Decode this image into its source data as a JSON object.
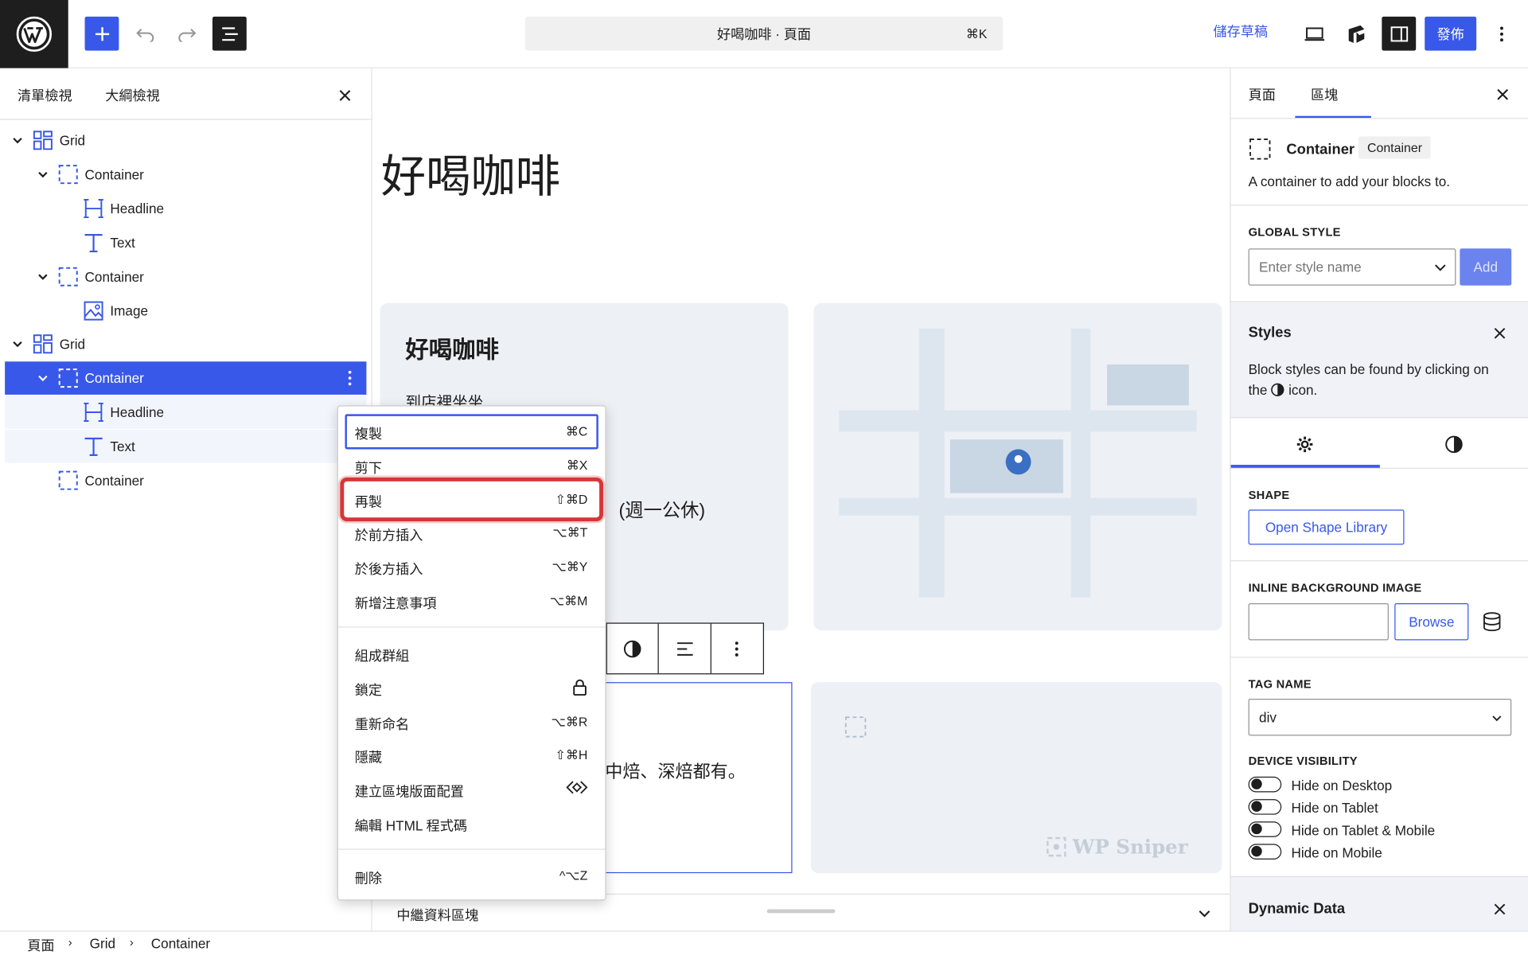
{
  "topbar": {
    "document_title": "好喝咖啡 · 頁面",
    "command_shortcut": "⌘K",
    "save_draft": "儲存草稿",
    "publish": "發佈"
  },
  "list_view": {
    "tabs": [
      "清單檢視",
      "大綱檢視"
    ],
    "items": [
      {
        "label": "Grid",
        "icon": "grid-icon",
        "expanded": true
      },
      {
        "label": "Container",
        "icon": "container-icon",
        "expanded": true
      },
      {
        "label": "Headline",
        "icon": "headline-icon"
      },
      {
        "label": "Text",
        "icon": "text-icon"
      },
      {
        "label": "Container",
        "icon": "container-icon",
        "expanded": true
      },
      {
        "label": "Image",
        "icon": "image-icon"
      },
      {
        "label": "Grid",
        "icon": "grid-icon",
        "expanded": true
      },
      {
        "label": "Container",
        "icon": "container-icon",
        "expanded": true,
        "selected": true
      },
      {
        "label": "Headline",
        "icon": "headline-icon"
      },
      {
        "label": "Text",
        "icon": "text-icon"
      },
      {
        "label": "Container",
        "icon": "container-icon"
      }
    ]
  },
  "canvas": {
    "page_title": "好喝咖啡",
    "card1_title": "好喝咖啡",
    "card1_subtitle": "到店裡坐坐",
    "card1_hours_fragment": "(週一公休)",
    "selected_text_fragment": "中焙、深焙都有。",
    "watermark": "WP Sniper",
    "footer_label": "中繼資料區塊"
  },
  "context_menu": {
    "group1": [
      {
        "label": "複製",
        "shortcut": "⌘C",
        "focused": true
      },
      {
        "label": "剪下",
        "shortcut": "⌘X"
      },
      {
        "label": "再製",
        "shortcut": "⇧⌘D",
        "highlighted": true
      },
      {
        "label": "於前方插入",
        "shortcut": "⌥⌘T"
      },
      {
        "label": "於後方插入",
        "shortcut": "⌥⌘Y"
      },
      {
        "label": "新增注意事項",
        "shortcut": "⌥⌘M"
      }
    ],
    "group2": [
      {
        "label": "組成群組",
        "shortcut": ""
      },
      {
        "label": "鎖定",
        "shortcut": "lock-icon"
      },
      {
        "label": "重新命名",
        "shortcut": "⌥⌘R"
      },
      {
        "label": "隱藏",
        "shortcut": "⇧⌘H"
      },
      {
        "label": "建立區塊版面配置",
        "shortcut": "pattern-icon"
      },
      {
        "label": "編輯 HTML 程式碼",
        "shortcut": ""
      }
    ],
    "group3": [
      {
        "label": "刪除",
        "shortcut": "^⌥Z"
      }
    ]
  },
  "breadcrumb": [
    "頁面",
    "Grid",
    "Container"
  ],
  "inspector": {
    "tabs": [
      "頁面",
      "區塊"
    ],
    "active_tab": "區塊",
    "block_name": "Container",
    "block_badge": "Container",
    "block_description": "A container to add your blocks to.",
    "global_style_label": "GLOBAL STYLE",
    "global_style_placeholder": "Enter style name",
    "add_label": "Add",
    "styles_title": "Styles",
    "styles_notice_1": "Block styles can be found by clicking on",
    "styles_notice_2a": "the",
    "styles_notice_2b": "icon.",
    "shape_label": "SHAPE",
    "shape_button": "Open Shape Library",
    "inline_bg_label": "INLINE BACKGROUND IMAGE",
    "browse_label": "Browse",
    "tag_name_label": "TAG NAME",
    "tag_name_value": "div",
    "device_visibility_label": "DEVICE VISIBILITY",
    "visibility_options": [
      "Hide on Desktop",
      "Hide on Tablet",
      "Hide on Tablet & Mobile",
      "Hide on Mobile"
    ],
    "dynamic_data_title": "Dynamic Data"
  },
  "colors": {
    "accent": "#3858e9",
    "highlight_outline": "#d63638",
    "card_bg": "#edf0f5",
    "map_road": "#dde6ef",
    "map_block": "#c9d6e3",
    "pin": "#3a6fc4"
  }
}
